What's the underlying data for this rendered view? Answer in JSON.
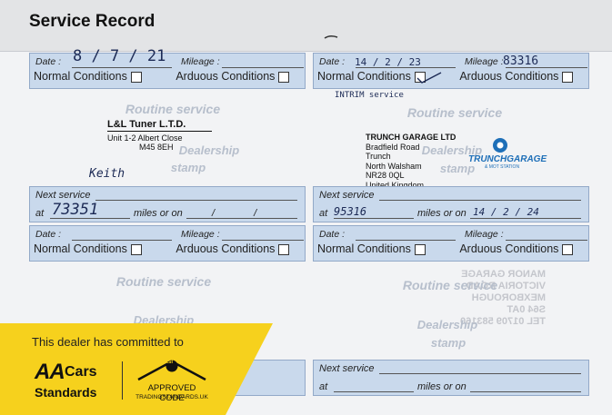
{
  "header": {
    "title": "Service Record"
  },
  "form": {
    "date_label": "Date :",
    "mileage_label": "Mileage :",
    "normal_label": "Normal Conditions",
    "arduous_label": "Arduous Conditions",
    "next_service_label": "Next service",
    "at_label": "at",
    "miles_or_on_label": "miles or on",
    "routine_service": "Routine service",
    "dealership_stamp_1": "Dealership",
    "dealership_stamp_2": "stamp"
  },
  "entries": [
    {
      "date": "8 / 7 / 21",
      "mileage": "",
      "next_at": "73351",
      "next_date": "/ /",
      "note": "Keith"
    },
    {
      "date": "14 / 2 / 23",
      "mileage": "83316",
      "next_at": "95316",
      "next_date": "14 / 2 / 24",
      "note": "INTRIM service"
    }
  ],
  "stamp_tuner": {
    "name": "L&L Tuner L.T.D.",
    "line1": "Unit 1-2 Albert Close",
    "line2": "M45 8EH"
  },
  "stamp_trunch": {
    "name": "TRUNCH GARAGE LTD",
    "lines": [
      "Bradfield Road",
      "Trunch",
      "North Walsham",
      "NR28 0QL",
      "United Kingdom"
    ],
    "logo_text": "TRUNCHGARAGE",
    "logo_sub": "& MOT STATION"
  },
  "mirror_stamp": {
    "lines": [
      "MANOR GARAGE",
      "VICTORIA ROAD",
      "MEXBOROUGH",
      "S64 0AT",
      "TEL 01709 583160"
    ]
  },
  "banner": {
    "text": "This dealer has committed to",
    "aa": "AA",
    "cars": "Cars",
    "standards": "Standards",
    "approved_code": "APPROVED CODE",
    "ts": "tsi",
    "trading_standards": "TRADINGSTANDARDS.UK",
    "colors": {
      "yellow": "#f6d11d",
      "dark": "#1a1a1a"
    }
  }
}
